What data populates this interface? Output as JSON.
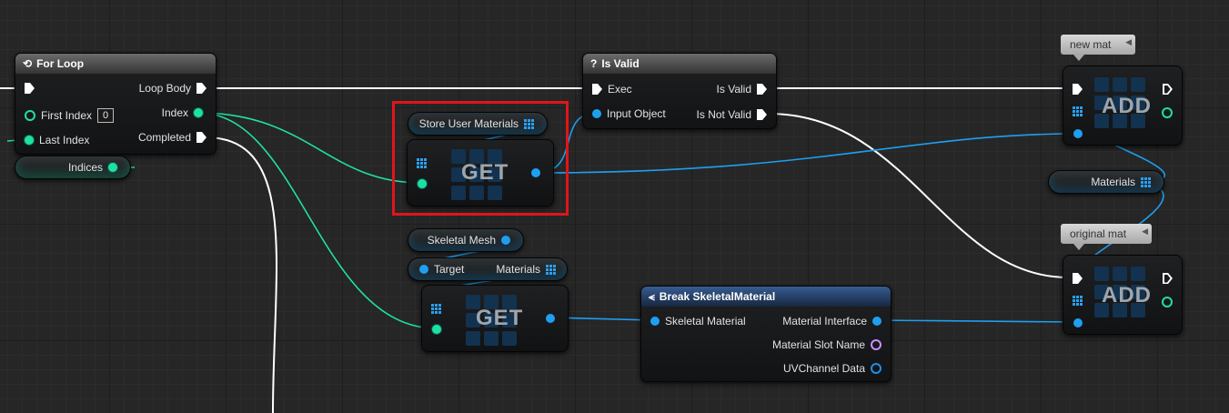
{
  "for_loop": {
    "title": "For Loop",
    "loop_body": "Loop Body",
    "first_index": "First Index",
    "first_index_value": "0",
    "index": "Index",
    "last_index": "Last Index",
    "completed": "Completed"
  },
  "indices_var": {
    "label": "Indices"
  },
  "store_user_materials": {
    "label": "Store User Materials"
  },
  "get_node_1": {
    "label": "GET"
  },
  "is_valid": {
    "title": "Is Valid",
    "exec": "Exec",
    "input_object": "Input Object",
    "is_valid_out": "Is Valid",
    "is_not_valid": "Is Not Valid"
  },
  "skeletal_mesh_var": {
    "label": "Skeletal Mesh"
  },
  "get_materials": {
    "target": "Target",
    "materials": "Materials"
  },
  "get_node_2": {
    "label": "GET"
  },
  "break_skeletal_material": {
    "title": "Break SkeletalMaterial",
    "skeletal_material": "Skeletal Material",
    "material_interface": "Material Interface",
    "material_slot_name": "Material Slot Name",
    "uv_channel_data": "UVChannel Data"
  },
  "comment_new_mat": {
    "label": "new mat"
  },
  "comment_original_mat": {
    "label": "original mat"
  },
  "add_node_1": {
    "label": "ADD"
  },
  "add_node_2": {
    "label": "ADD"
  },
  "materials_var": {
    "label": "Materials"
  },
  "colors": {
    "exec_wire": "#ffffff",
    "int_wire": "#1fe0a4",
    "object_wire": "#1f9ff0",
    "highlight": "#e0151b"
  }
}
